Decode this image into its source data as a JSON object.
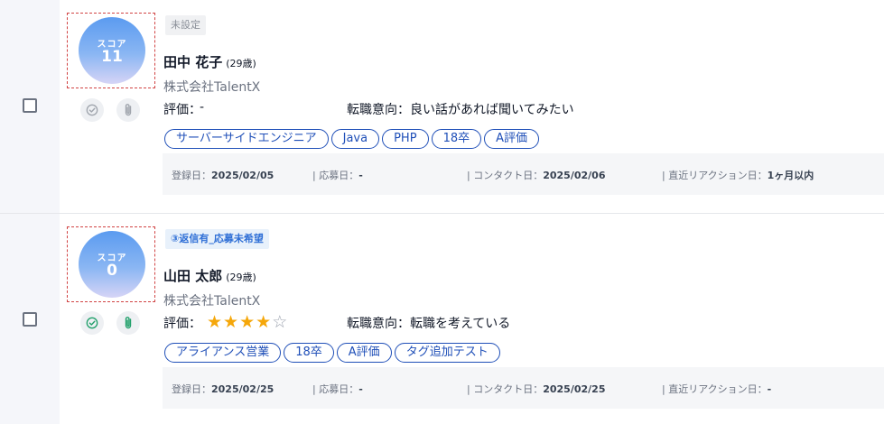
{
  "candidates": [
    {
      "score_label": "スコア",
      "score": "11",
      "status": "未設定",
      "name": "田中 花子",
      "age": "(29歳)",
      "company": "株式会社TalentX",
      "eval_label": "評価：",
      "eval_value": "-",
      "rating": 0,
      "intent": "転職意向：良い話があれば聞いてみたい",
      "tags": [
        "サーバーサイドエンジニア",
        "Java",
        "PHP",
        "18卒",
        "A評価"
      ],
      "dates": {
        "registered_label": "登録日：",
        "registered": "2025/02/05",
        "applied_label": "| 応募日：",
        "applied": "-",
        "contact_label": "| コンタクト日：",
        "contact": "2025/02/06",
        "reaction_label": "| 直近リアクション日：",
        "reaction": "1ヶ月以内"
      },
      "icon_check_color": "#a0a5ad",
      "icon_clip_color": "#a0a5ad"
    },
    {
      "score_label": "スコア",
      "score": "0",
      "status": "③返信有_応募未希望",
      "name": "山田 太郎",
      "age": "(29歳)",
      "company": "株式会社TalentX",
      "eval_label": "評価：",
      "eval_value": "",
      "rating": 4,
      "intent": "転職意向：転職を考えている",
      "tags": [
        "アライアンス営業",
        "18卒",
        "A評価",
        "タグ追加テスト"
      ],
      "dates": {
        "registered_label": "登録日：",
        "registered": "2025/02/25",
        "applied_label": "| 応募日：",
        "applied": "-",
        "contact_label": "| コンタクト日：",
        "contact": "2025/02/25",
        "reaction_label": "| 直近リアクション日：",
        "reaction": "-"
      },
      "icon_check_color": "#22a06b",
      "icon_clip_color": "#22a06b"
    }
  ],
  "icons": {
    "checkbox": "checkbox",
    "check": "check-circle-icon",
    "clip": "paperclip-icon",
    "star": "star-icon"
  },
  "colors": {
    "tag_border": "#1f4fb8",
    "star_on": "#f5a70a",
    "star_off": "#9ca3af",
    "score_gradient_top": "#5b9bf0",
    "score_gradient_bottom": "#d6d4f6"
  }
}
